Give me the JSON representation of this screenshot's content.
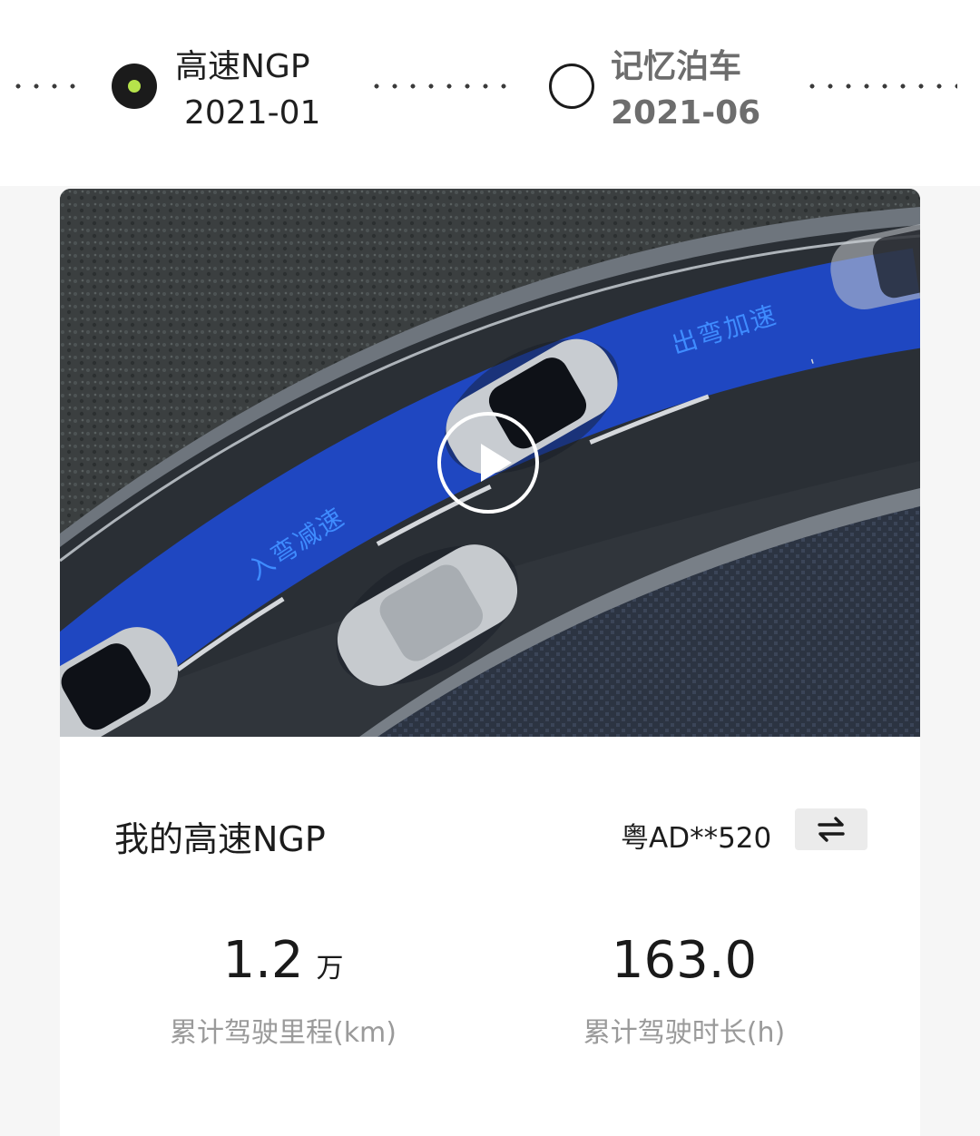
{
  "timeline": {
    "milestones": [
      {
        "title": "高速NGP",
        "date": "2021-01",
        "active": true
      },
      {
        "title": "记忆泊车",
        "date": "2021-06",
        "active": false
      }
    ],
    "active_dot_color": "#b6e34b"
  },
  "video": {
    "label_exit": "出弯加速",
    "label_enter": "入弯减速",
    "lane_color": "#1f49c9"
  },
  "card": {
    "title": "我的高速NGP",
    "plate": "粤AD**520",
    "swap_icon": "swap-arrows-icon",
    "stats": [
      {
        "value": "1.2",
        "unit": "万",
        "label": "累计驾驶里程(km)"
      },
      {
        "value": "163.0",
        "unit": "",
        "label": "累计驾驶时长(h)"
      }
    ]
  }
}
